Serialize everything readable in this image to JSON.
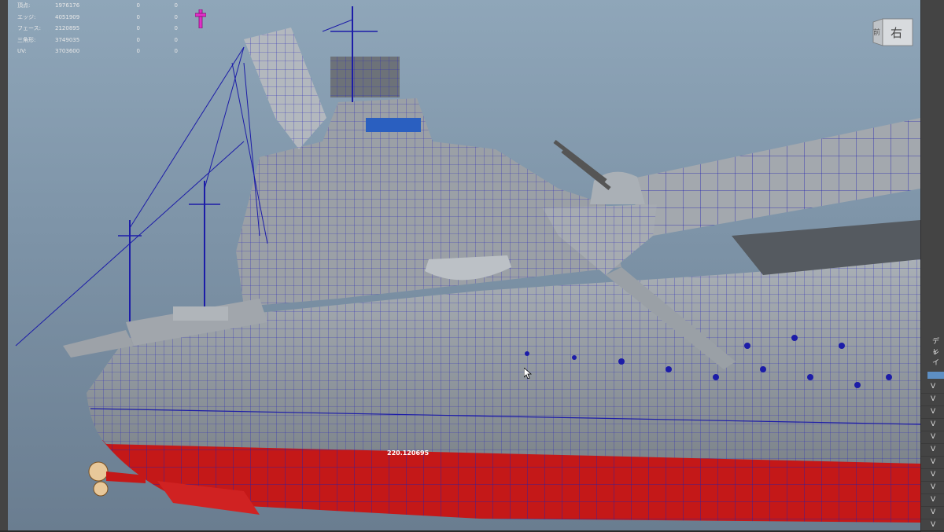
{
  "hud": {
    "rows": [
      {
        "label": "頂点:",
        "value": "1976176",
        "c1": "0",
        "c2": "0"
      },
      {
        "label": "エッジ:",
        "value": "4051909",
        "c1": "0",
        "c2": "0"
      },
      {
        "label": "フェース:",
        "value": "2120895",
        "c1": "0",
        "c2": "0"
      },
      {
        "label": "三角形:",
        "value": "3749035",
        "c1": "0",
        "c2": "0"
      },
      {
        "label": "UV:",
        "value": "3703600",
        "c1": "0",
        "c2": "0"
      }
    ]
  },
  "viewcube": {
    "front": "前",
    "right": "右"
  },
  "dimension_label": "220.120695",
  "right_panel": {
    "label1": "ディ",
    "label2": "レイ",
    "items": [
      "V",
      "V",
      "V",
      "V",
      "V",
      "V",
      "V",
      "V",
      "V",
      "V",
      "V",
      "V"
    ]
  },
  "colors": {
    "viewport_top": "#8fa6b9",
    "viewport_bottom": "#6a7d90",
    "hull_grey": "#9a9ea3",
    "hull_red": "#c41818",
    "wireframe": "#1c1ca8",
    "pivot": "#e030c8",
    "panel_bg": "#444444",
    "selection_blue": "#5d8fc4"
  },
  "icons": [
    "pivot-icon",
    "view-cube-icon",
    "mouse-cursor-icon",
    "propeller-icon"
  ]
}
